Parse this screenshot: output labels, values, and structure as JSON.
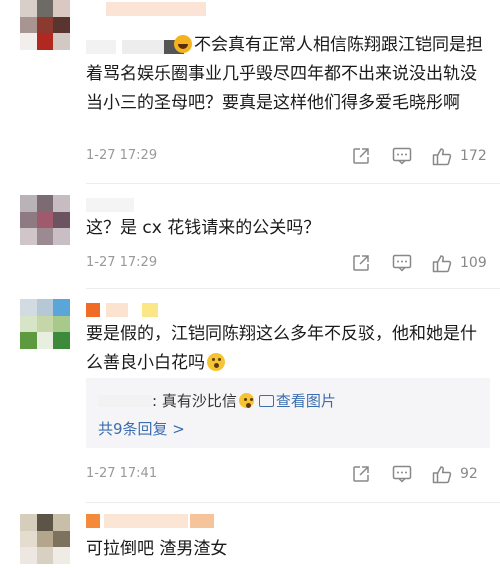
{
  "comments": [
    {
      "text_parts": [
        "不会真有正常人相信陈翔跟江铠同是担着骂名娱乐圈事业几乎毁尽四年都不出来说没出轨没当小三的圣母吧？要真是这样他们得多爱毛晓彤啊"
      ],
      "time": "1-27 17:29",
      "likes": "172"
    },
    {
      "text": "这？是 cx 花钱请来的公关吗？",
      "time": "1-27 17:29",
      "likes": "109"
    },
    {
      "text": "要是假的，江铠同陈翔这么多年不反驳，他和她是什么善良小白花吗",
      "reply": {
        "text": ": 真有沙比信",
        "image_link": "查看图片",
        "more": "共9条回复 >"
      },
      "time": "1-27 17:41",
      "likes": "92"
    },
    {
      "text": "可拉倒吧 渣男渣女"
    }
  ],
  "colors": {
    "link": "#3b6db0",
    "meta": "#999999",
    "accent_emoji": "#f6b21d"
  },
  "icons": [
    "laughing-emoji-icon",
    "thinking-emoji-icon",
    "share-icon",
    "comment-icon",
    "thumbs-up-icon",
    "image-icon"
  ]
}
